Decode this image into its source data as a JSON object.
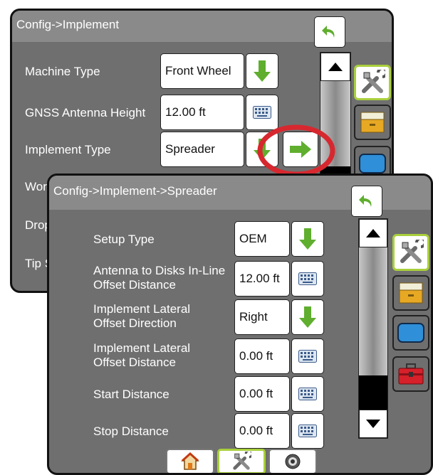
{
  "back_panel": {
    "title": "Config->Implement",
    "rows": [
      {
        "label": "Machine Type",
        "value": "Front Wheel",
        "control": "dropdown"
      },
      {
        "label": "GNSS Antenna Height",
        "value": "12.00 ft",
        "control": "keyboard"
      },
      {
        "label": "Implement Type",
        "value": "Spreader",
        "control": "dropdown"
      },
      {
        "label": "Wor",
        "value": "",
        "control": ""
      },
      {
        "label": "Drop",
        "value": "",
        "control": ""
      },
      {
        "label": "Tip S",
        "value": "",
        "control": ""
      }
    ]
  },
  "front_panel": {
    "title": "Config->Implement->Spreader",
    "rows": [
      {
        "label": "Setup Type",
        "value": "OEM",
        "control": "dropdown"
      },
      {
        "label": "Antenna to Disks In-Line Offset Distance",
        "value": "12.00 ft",
        "control": "keyboard"
      },
      {
        "label": "Implement Lateral Offset Direction",
        "value": "Right",
        "control": "dropdown"
      },
      {
        "label": "Implement Lateral Offset Distance",
        "value": "0.00 ft",
        "control": "keyboard"
      },
      {
        "label": "Start Distance",
        "value": "0.00 ft",
        "control": "keyboard"
      },
      {
        "label": "Stop Distance",
        "value": "0.00 ft",
        "control": "keyboard"
      }
    ]
  },
  "side_tabs": [
    "tools-icon",
    "folder-icon",
    "screen-icon",
    "toolbox-icon"
  ],
  "bottom_tabs": [
    "home-icon",
    "tools-icon",
    "gauge-icon"
  ],
  "colors": {
    "panel": "#6f6f6f",
    "accent_green": "#a9cf3c",
    "arrow_green": "#5fae2e",
    "highlight_circle": "#d7282f"
  }
}
